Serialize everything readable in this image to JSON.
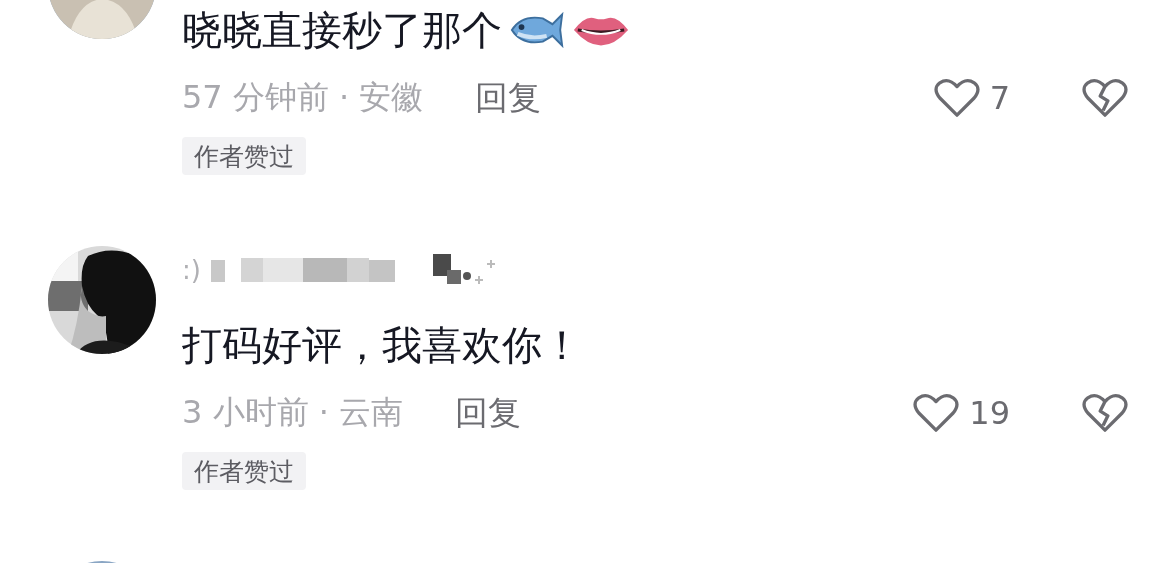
{
  "comments": [
    {
      "avatar": {
        "kind": "picture"
      },
      "text": "晓晓直接秒了那个",
      "emojis": [
        {
          "kind": "fish"
        },
        {
          "kind": "lips"
        }
      ],
      "meta": "57 分钟前 · 安徽",
      "reply": "回复",
      "likes": "7",
      "badge": "作者赞过"
    },
    {
      "avatar": {
        "kind": "picture"
      },
      "username": ":)",
      "username_masked": true,
      "text": "打码好评，我喜欢你！",
      "meta": "3 小时前 · 云南",
      "reply": "回复",
      "likes": "19",
      "badge": "作者赞过"
    },
    {
      "avatar": {
        "kind": "picture"
      }
    }
  ]
}
